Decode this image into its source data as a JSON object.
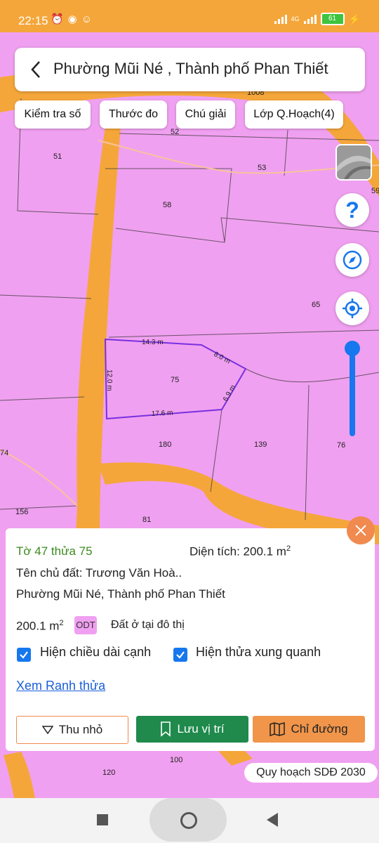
{
  "status": {
    "time": "22:15",
    "battery": "61",
    "network": "4G"
  },
  "search": {
    "title": "Phường Mũi Né , Thành phố Phan Thiết"
  },
  "chips": [
    "Kiểm tra số",
    "Thước đo",
    "Chú giải",
    "Lớp Q.Hoạch(4)"
  ],
  "map": {
    "parcels": [
      "51",
      "52",
      "53",
      "58",
      "65",
      "75",
      "180",
      "139",
      "76",
      "156",
      "81",
      "100",
      "120",
      "1008",
      "59",
      "74"
    ],
    "edges": [
      "14.3 m",
      "8.0 m",
      "6.9 m",
      "17.6 m",
      "12.0 m"
    ]
  },
  "panel": {
    "parcel_id": "Tờ 47 thửa 75",
    "area_label": "Diện tích: 200.1 m",
    "area_sup": "2",
    "owner": "Tên chủ đất: Trương Văn Hoà..",
    "address": "Phường Mũi Né, Thành phố Phan Thiết",
    "land_area": "200.1 m",
    "land_area_sup": "2",
    "land_code": "ODT",
    "land_desc": "Đất ở tại đô thị",
    "check1": "Hiện chiều dài cạnh",
    "check2": "Hiện thửa xung quanh",
    "link": "Xem Ranh thửa",
    "btn_collapse": "Thu nhỏ",
    "btn_save": "Lưu vị trí",
    "btn_direction": "Chỉ đường"
  },
  "plan_pill": "Quy hoạch SDĐ 2030",
  "colors": {
    "land": "#f0a0f0",
    "road": "#f5a63a",
    "accent": "#1677ee",
    "green": "#1f8a4c",
    "orange": "#f0954a"
  }
}
